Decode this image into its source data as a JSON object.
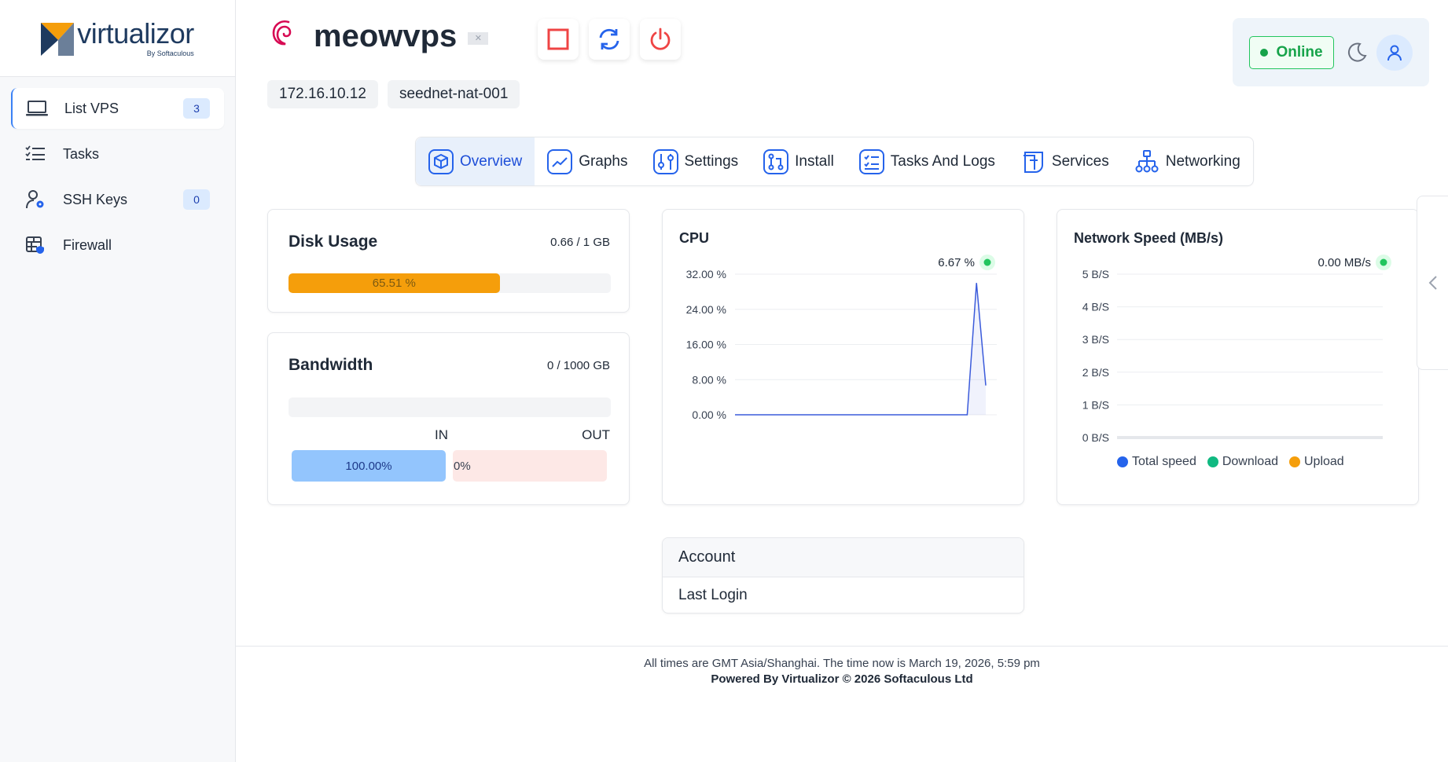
{
  "brand": {
    "name": "virtualizor",
    "sub": "By Softaculous"
  },
  "sidebar": {
    "items": [
      {
        "label": "List VPS",
        "badge": "3",
        "icon": "laptop-icon"
      },
      {
        "label": "Tasks",
        "icon": "task-list-icon"
      },
      {
        "label": "SSH Keys",
        "badge": "0",
        "icon": "user-key-icon"
      },
      {
        "label": "Firewall",
        "icon": "firewall-icon"
      }
    ]
  },
  "vps": {
    "name": "meowvps",
    "os_icon": "debian-icon",
    "ip": "172.16.10.12",
    "node": "seednet-nat-001"
  },
  "controls": {
    "stop_icon": "stop-icon",
    "restart_icon": "restart-icon",
    "power_icon": "power-icon"
  },
  "status": {
    "label": "Online",
    "color": "#16a34a"
  },
  "tabs": [
    {
      "label": "Overview",
      "icon": "cube-icon"
    },
    {
      "label": "Graphs",
      "icon": "graph-icon"
    },
    {
      "label": "Settings",
      "icon": "sliders-icon"
    },
    {
      "label": "Install",
      "icon": "install-icon"
    },
    {
      "label": "Tasks And Logs",
      "icon": "tasks-logs-icon"
    },
    {
      "label": "Services",
      "icon": "services-icon"
    },
    {
      "label": "Networking",
      "icon": "network-icon"
    }
  ],
  "disk": {
    "title": "Disk Usage",
    "usage": "0.66 / 1 GB",
    "percent_label": "65.51 %",
    "percent": 65.51
  },
  "bandwidth": {
    "title": "Bandwidth",
    "usage": "0 / 1000 GB",
    "in_label": "IN",
    "out_label": "OUT",
    "in_value": "100.00%",
    "out_value": "0%"
  },
  "account": {
    "title": "Account",
    "last_login_label": "Last Login"
  },
  "chart_data": [
    {
      "type": "area",
      "title": "CPU",
      "current_label": "6.67 %",
      "yticks": [
        "32.00 %",
        "24.00 %",
        "16.00 %",
        "8.00 %",
        "0.00 %"
      ],
      "ylim": [
        0,
        32
      ],
      "x": [
        0,
        1,
        2,
        3,
        4,
        5,
        6,
        7,
        8,
        9,
        10,
        11,
        12,
        13,
        14,
        15,
        16,
        17,
        18,
        19,
        20,
        21,
        22,
        23,
        24,
        25,
        26,
        27
      ],
      "series": [
        {
          "values": [
            0,
            0,
            0,
            0,
            0,
            0,
            0,
            0,
            0,
            0,
            0,
            0,
            0,
            0,
            0,
            0,
            0,
            0,
            0,
            0,
            0,
            0,
            0,
            0,
            0,
            0,
            30,
            6.67
          ]
        }
      ],
      "colors": {
        "line": "#3b5bdb",
        "current": "#22c55e"
      }
    },
    {
      "type": "line",
      "title": "Network Speed (MB/s)",
      "current_label": "0.00 MB/s",
      "yticks": [
        "5 B/S",
        "4 B/S",
        "3 B/S",
        "2 B/S",
        "1 B/S",
        "0 B/S"
      ],
      "ylim": [
        0,
        5
      ],
      "series": [
        {
          "name": "Total speed",
          "color": "#2563eb",
          "values": [
            0,
            0,
            0,
            0,
            0,
            0,
            0,
            0,
            0,
            0
          ]
        },
        {
          "name": "Download",
          "color": "#10b981",
          "values": [
            0,
            0,
            0,
            0,
            0,
            0,
            0,
            0,
            0,
            0
          ]
        },
        {
          "name": "Upload",
          "color": "#f59e0b",
          "values": [
            0,
            0,
            0,
            0,
            0,
            0,
            0,
            0,
            0,
            0
          ]
        }
      ]
    }
  ],
  "footer": {
    "line1": "All times are GMT Asia/Shanghai. The time now is March 19, 2026, 5:59 pm",
    "line2": "Powered By Virtualizor © 2026 Softaculous Ltd"
  }
}
